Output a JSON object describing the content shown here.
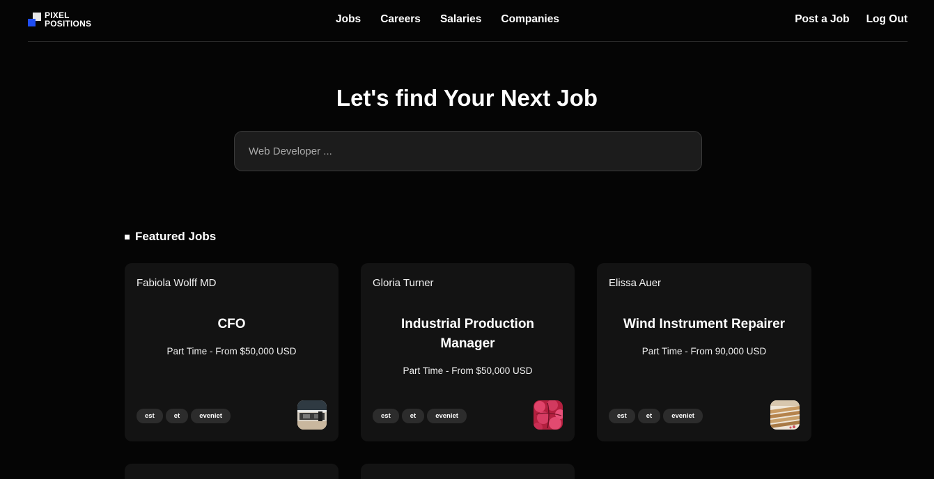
{
  "brand": {
    "line1": "PIXEL",
    "line2": "POSITIONS",
    "accent": "#1f4ef5"
  },
  "nav": {
    "links": [
      "Jobs",
      "Careers",
      "Salaries",
      "Companies"
    ],
    "right": [
      "Post a Job",
      "Log Out"
    ]
  },
  "hero": {
    "title": "Let's find Your Next Job",
    "search_placeholder": "Web Developer ..."
  },
  "featured": {
    "heading": "Featured Jobs",
    "cards": [
      {
        "employer": "Fabiola Wolff MD",
        "title": "CFO",
        "meta": "Part Time - From $50,000 USD",
        "tags": [
          "est",
          "et",
          "eveniet"
        ],
        "logo_icon": "office-photo-icon"
      },
      {
        "employer": "Gloria Turner",
        "title": "Industrial Production Manager",
        "meta": "Part Time - From $50,000 USD",
        "tags": [
          "est",
          "et",
          "eveniet"
        ],
        "logo_icon": "red-fabric-photo-icon"
      },
      {
        "employer": "Elissa Auer",
        "title": "Wind Instrument Repairer",
        "meta": "Part Time - From 90,000 USD",
        "tags": [
          "est",
          "et",
          "eveniet"
        ],
        "logo_icon": "wood-panels-photo-icon"
      }
    ]
  }
}
